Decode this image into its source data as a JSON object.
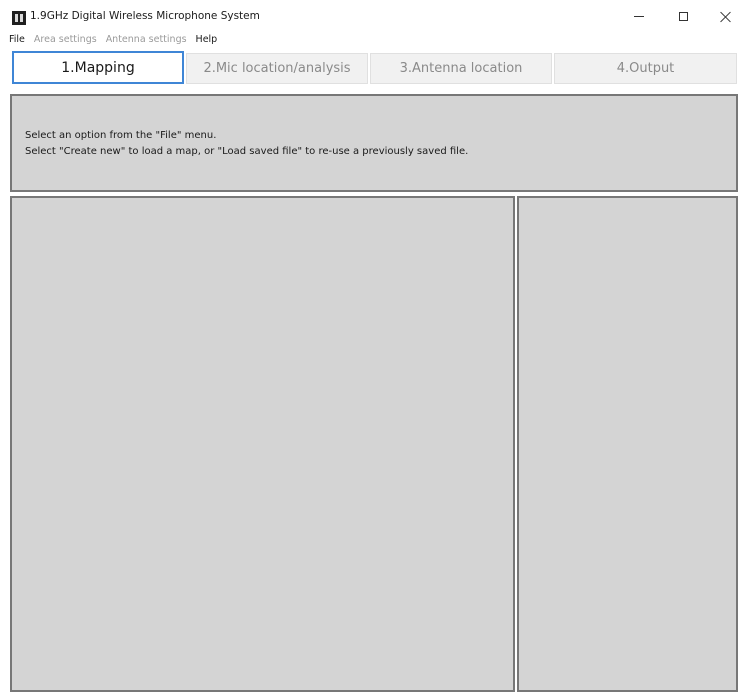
{
  "window": {
    "title": "1.9GHz Digital Wireless Microphone System",
    "controls": [
      "minimize",
      "maximize",
      "close"
    ]
  },
  "menu": {
    "items": [
      {
        "label": "File",
        "enabled": true
      },
      {
        "label": "Area settings",
        "enabled": false
      },
      {
        "label": "Antenna settings",
        "enabled": false
      },
      {
        "label": "Help",
        "enabled": true
      }
    ]
  },
  "tabs": [
    {
      "label": "1.Mapping",
      "active": true
    },
    {
      "label": "2.Mic location/analysis",
      "active": false
    },
    {
      "label": "3.Antenna location",
      "active": false
    },
    {
      "label": "4.Output",
      "active": false
    }
  ],
  "info": {
    "line1": "Select an option from the \"File\" menu.",
    "line2": "Select \"Create new\" to load a map, or \"Load saved file\" to re-use a previously saved file."
  },
  "colors": {
    "active_tab_border": "#3f86d6",
    "panel_background": "#d4d4d4",
    "panel_border": "#777777",
    "disabled_text": "#9a9a9a"
  },
  "icons": {
    "app": "app-logo-icon",
    "minimize": "minimize-icon",
    "maximize": "maximize-icon",
    "close": "close-icon"
  }
}
